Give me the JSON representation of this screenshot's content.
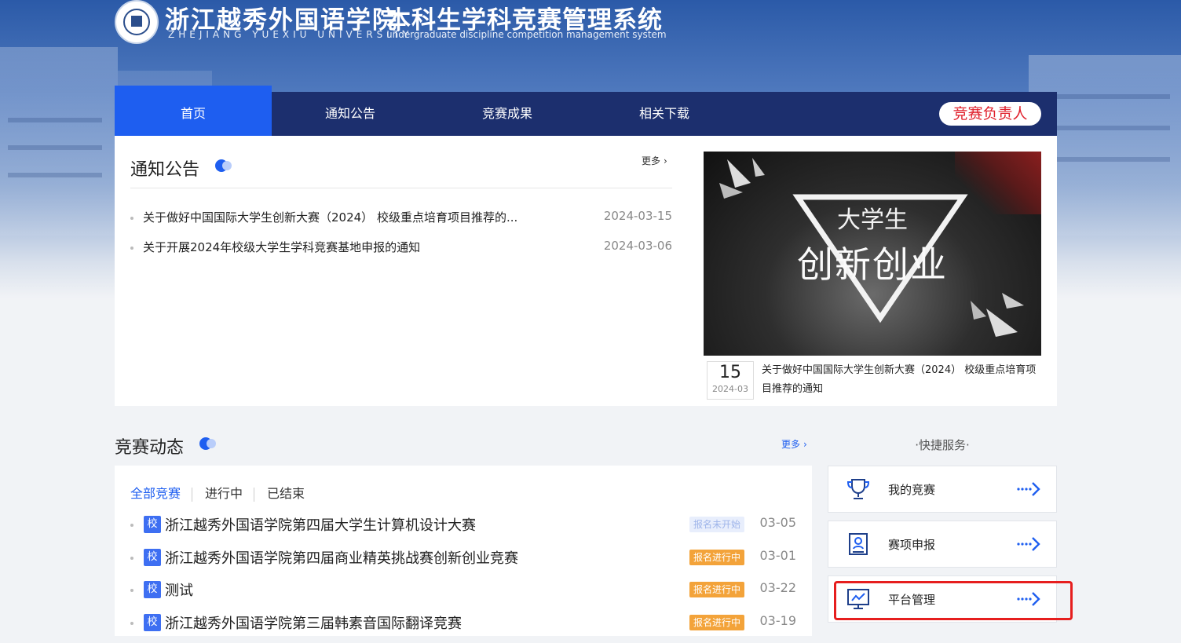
{
  "header": {
    "school_cn": "浙江越秀外国语学院",
    "school_en": "ZHEJIANG YUEXIU UNIVERSITY",
    "system_cn": "本科生学科竞赛管理系统",
    "system_en": "undergraduate discipline competition management system"
  },
  "nav": {
    "items": [
      {
        "label": "首页",
        "active": true
      },
      {
        "label": "通知公告"
      },
      {
        "label": "竞赛成果"
      },
      {
        "label": "相关下载"
      }
    ],
    "role_button": "竞赛负责人"
  },
  "notices": {
    "title": "通知公告",
    "more": "更多",
    "items": [
      {
        "title": "关于做好中国国际大学生创新大赛（2024） 校级重点培育项目推荐的...",
        "date": "2024-03-15"
      },
      {
        "title": "关于开展2024年校级大学生学科竞赛基地申报的通知",
        "date": "2024-03-06"
      }
    ]
  },
  "banner": {
    "line1": "大学生",
    "line2": "创新创业",
    "day": "15",
    "year_month": "2024-03",
    "caption": "关于做好中国国际大学生创新大赛（2024） 校级重点培育项目推荐的通知"
  },
  "competitions": {
    "title": "竞赛动态",
    "more": "更多",
    "tabs": [
      "全部竞赛",
      "进行中",
      "已结束"
    ],
    "items": [
      {
        "tag": "校",
        "title": "浙江越秀外国语学院第四届大学生计算机设计大赛",
        "status": "报名未开始",
        "date": "03-05"
      },
      {
        "tag": "校",
        "title": "浙江越秀外国语学院第四届商业精英挑战赛创新创业竞赛",
        "status": "报名进行中",
        "date": "03-01"
      },
      {
        "tag": "校",
        "title": "测试",
        "status": "报名进行中",
        "date": "03-22"
      },
      {
        "tag": "校",
        "title": "浙江越秀外国语学院第三届韩素音国际翻译竞赛",
        "status": "报名进行中",
        "date": "03-19"
      }
    ]
  },
  "quick_services": {
    "title": "·快捷服务·",
    "items": [
      {
        "label": "我的竞赛",
        "icon": "trophy-icon"
      },
      {
        "label": "赛项申报",
        "icon": "clipboard-user-icon"
      },
      {
        "label": "平台管理",
        "icon": "monitor-chart-icon"
      }
    ]
  },
  "colors": {
    "accent": "#1e5ef0",
    "nav_bg": "#1c2f6e",
    "status_active": "#f3a33a",
    "highlight": "#e61e1e"
  }
}
